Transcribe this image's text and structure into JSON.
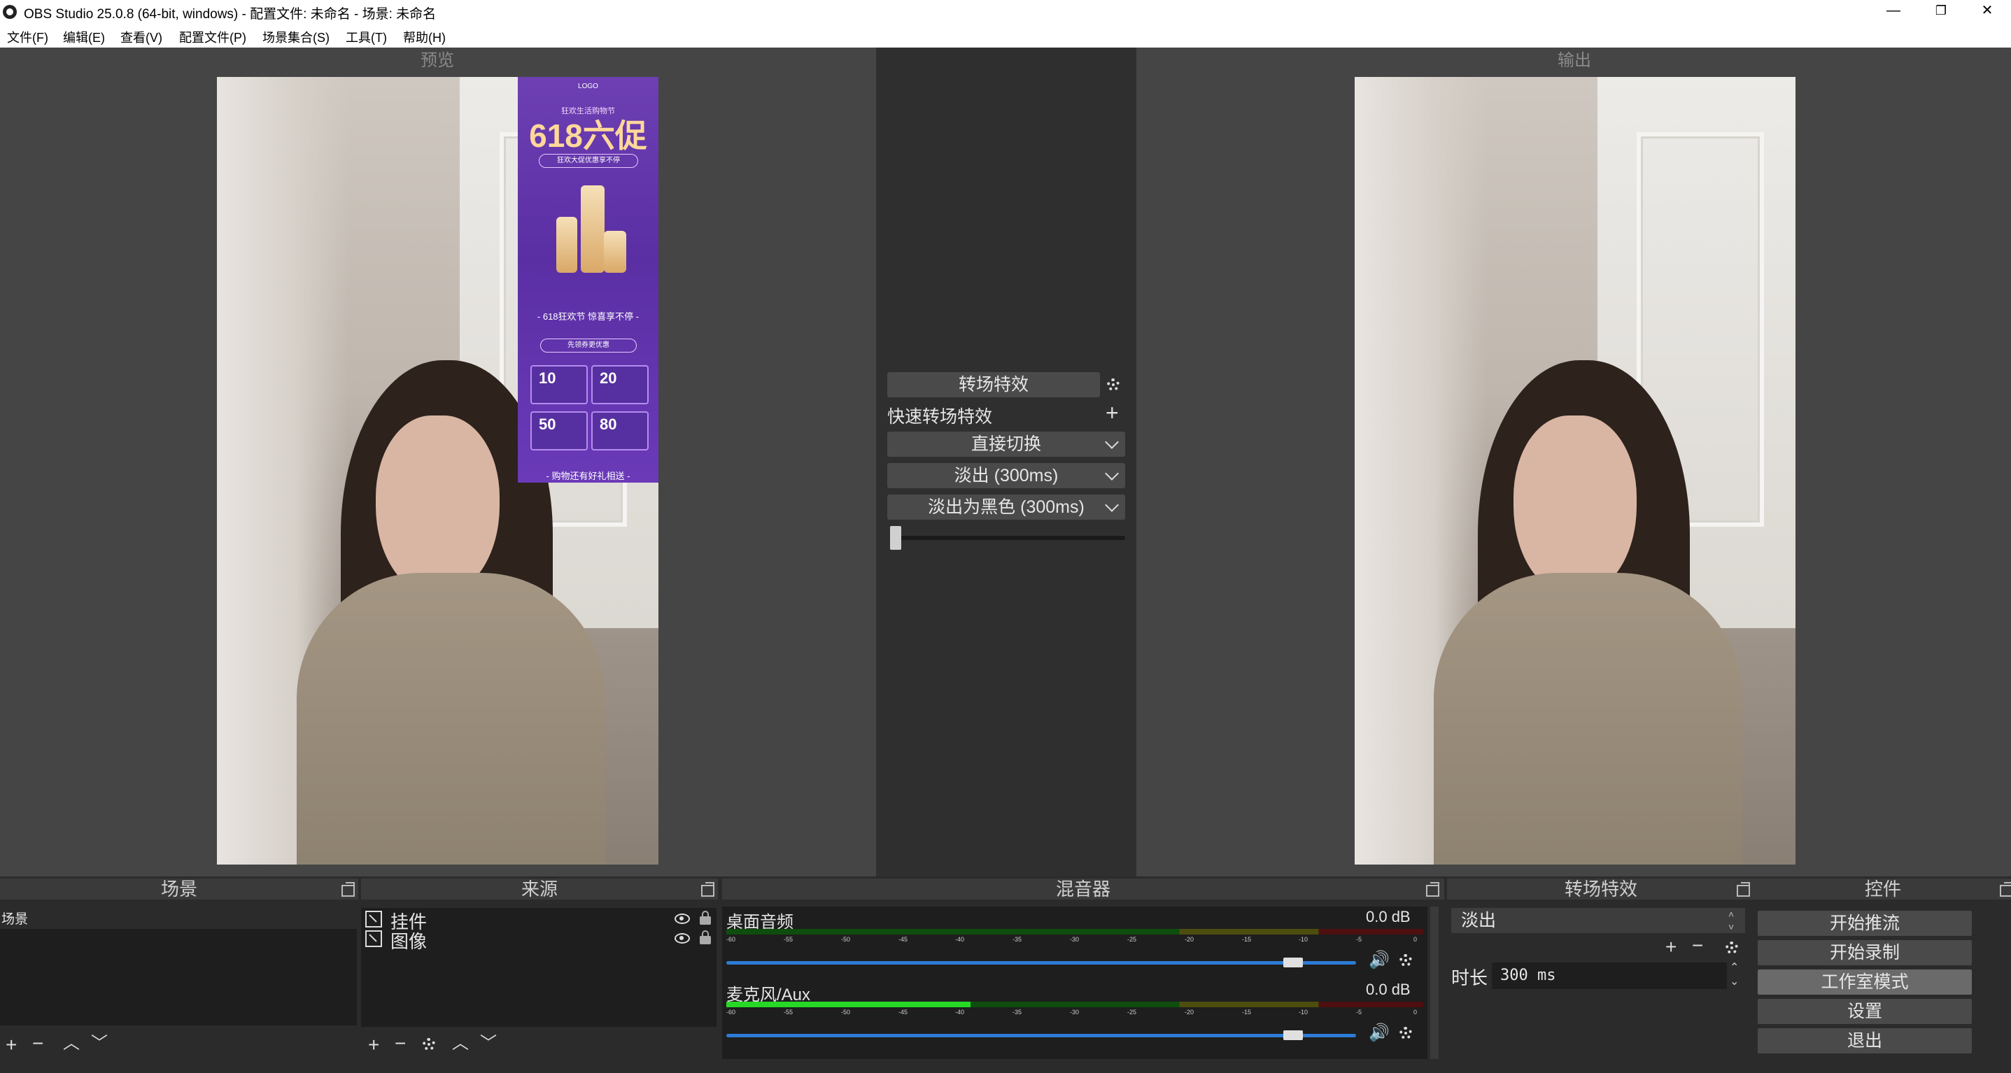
{
  "window": {
    "title": "OBS Studio 25.0.8 (64-bit, windows) - 配置文件: 未命名 - 场景: 未命名",
    "minimize": "—",
    "restore": "❐",
    "close": "✕"
  },
  "menu": [
    "文件(F)",
    "编辑(E)",
    "查看(V)",
    "配置文件(P)",
    "场景集合(S)",
    "工具(T)",
    "帮助(H)"
  ],
  "preview": {
    "label": "预览"
  },
  "output": {
    "label": "输出"
  },
  "ad_overlay": {
    "logo": "LOGO",
    "kicker": "狂欢生活购物节",
    "headline": "618六促",
    "sub": "狂欢大促优惠享不停",
    "banner": "- 618狂欢节 惊喜享不停 -",
    "button": "先领券更优惠",
    "coupons": [
      "10",
      "20",
      "50",
      "80"
    ],
    "footer": "- 购物还有好礼相送 -"
  },
  "transition_center": {
    "header": "转场特效",
    "quick_label": "快速转场特效",
    "items": [
      "直接切换",
      "淡出 (300ms)",
      "淡出为黑色 (300ms)"
    ],
    "tbar_value": 0
  },
  "docks": {
    "scenes": {
      "title": "场景",
      "items": [
        "场景"
      ]
    },
    "sources": {
      "title": "来源",
      "items": [
        "挂件",
        "图像"
      ]
    },
    "mixer": {
      "title": "混音器",
      "channels": [
        {
          "name": "桌面音频",
          "db": "0.0 dB",
          "level": 0.0,
          "volume": 0.9
        },
        {
          "name": "麦克风/Aux",
          "db": "0.0 dB",
          "level": 0.35,
          "volume": 0.9
        }
      ],
      "ticks": [
        "-60",
        "-55",
        "-50",
        "-45",
        "-40",
        "-35",
        "-30",
        "-25",
        "-20",
        "-15",
        "-10",
        "-5",
        "0"
      ]
    },
    "transitions": {
      "title": "转场特效",
      "selected": "淡出",
      "duration_label": "时长",
      "duration_value": "300 ms"
    },
    "controls": {
      "title": "控件",
      "buttons": [
        "开始推流",
        "开始录制",
        "工作室模式",
        "设置",
        "退出"
      ]
    }
  },
  "colors": {
    "accent_blue": "#2c7bd6",
    "meter_green": "#27d827",
    "panel_dark": "#1e1e1e",
    "canvas_gray": "#454545",
    "ad_purple": "#6d3fb3"
  }
}
